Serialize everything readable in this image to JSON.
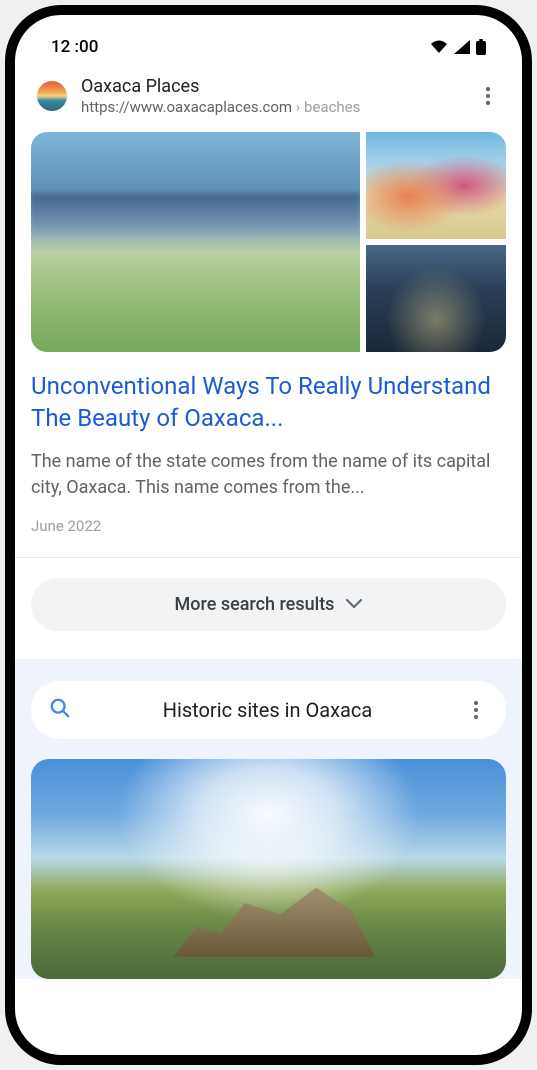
{
  "status": {
    "time": "12 :00"
  },
  "result": {
    "site_name": "Oaxaca Places",
    "site_url": "https://www.oaxacaplaces.com",
    "breadcrumb_sep": " › ",
    "breadcrumb": "beaches",
    "title": "Unconventional Ways To Really Understand The Beauty of Oaxaca...",
    "snippet": "The name of the state comes from the name of its capital city, Oaxaca. This name comes from the...",
    "date": "June 2022"
  },
  "more_results_label": "More search results",
  "related": {
    "title": "Historic sites in Oaxaca"
  }
}
